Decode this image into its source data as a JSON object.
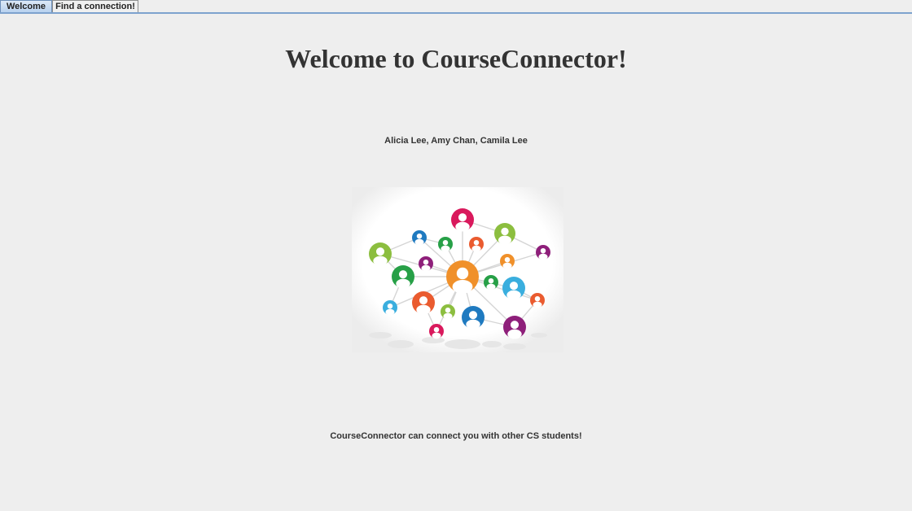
{
  "tabs": [
    {
      "label": "Welcome",
      "active": true
    },
    {
      "label": "Find a connection!",
      "active": false
    }
  ],
  "main": {
    "title": "Welcome to CourseConnector!",
    "authors": "Alicia Lee, Amy Chan, Camila Lee",
    "image_icon": "network-people-icon",
    "tagline": "CourseConnector can connect you with other CS students!"
  },
  "colors": {
    "orange": "#f0902a",
    "red": "#d9195c",
    "lime": "#8cbe3f",
    "green": "#27a047",
    "blue": "#1f7ac0",
    "cyan": "#3aaede",
    "purple": "#8e1f7a",
    "coral": "#ea5b2f"
  }
}
